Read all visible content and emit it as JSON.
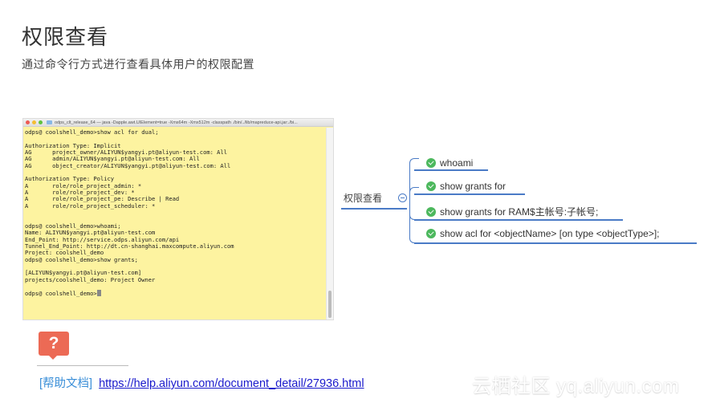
{
  "header": {
    "title": "权限查看",
    "subtitle": "通过命令行方式进行查看具体用户的权限配置"
  },
  "terminal": {
    "window_title": "odps_clt_release_64 — java -Dapple.awt.UIElement=true -Xms64m -Xmx512m -classpath ./bin/../lib/mapreduce-api.jar:./bi...",
    "lines": [
      "odps@ coolshell_demo>show acl for dual;",
      "",
      "Authorization Type: Implicit",
      "AG      project_owner/ALIYUN$yangyi.pt@aliyun-test.com: All",
      "AG      admin/ALIYUN$yangyi.pt@aliyun-test.com: All",
      "AG      object_creator/ALIYUN$yangyi.pt@aliyun-test.com: All",
      "",
      "Authorization Type: Policy",
      "A       role/role_project_admin: *",
      "A       role/role_project_dev: *",
      "A       role/role_project_pe: Describe | Read",
      "A       role/role_project_scheduler: *",
      "",
      "",
      "odps@ coolshell_demo>whoami;",
      "Name: ALIYUN$yangyi.pt@aliyun-test.com",
      "End_Point: http://service.odps.aliyun.com/api",
      "Tunnel_End_Point: http://dt.cn-shanghai.maxcompute.aliyun.com",
      "Project: coolshell_demo",
      "odps@ coolshell_demo>show grants;",
      "",
      "[ALIYUN$yangyi.pt@aliyun-test.com]",
      "projects/coolshell_demo: Project Owner",
      "",
      "odps@ coolshell_demo>"
    ]
  },
  "mindmap": {
    "root": "权限查看",
    "nodes": [
      {
        "label": "whoami",
        "icon": "check-icon"
      },
      {
        "label": "show grants for",
        "icon": "check-icon"
      },
      {
        "label": "show grants for RAM$主帐号:子帐号;",
        "icon": "check-icon"
      },
      {
        "label": "show acl for <objectName> [on type <objectType>];",
        "icon": "check-icon"
      }
    ]
  },
  "help": {
    "icon": "question-mark",
    "label": "[帮助文档]",
    "link": "https://help.aliyun.com/document_detail/27936.html"
  },
  "watermark": "云栖社区 yq.aliyun.com",
  "colors": {
    "terminal_bg": "#fdf3a0",
    "mindmap_line": "#4a7bc6",
    "check": "#4cb85d",
    "help_icon": "#ec6a55",
    "help_label": "#3b8fd8",
    "link": "#1a1acc"
  }
}
